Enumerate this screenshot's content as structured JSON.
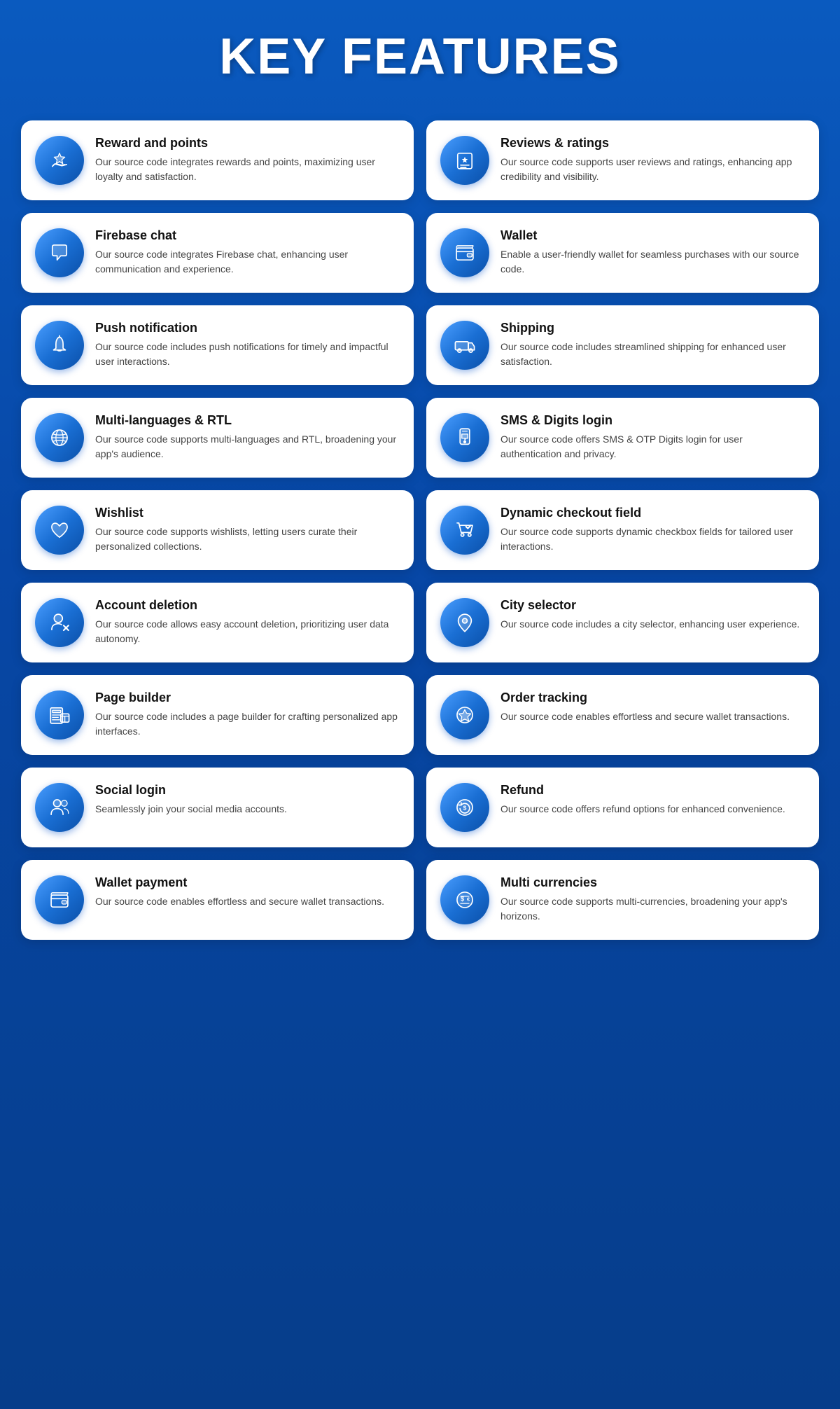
{
  "page": {
    "title": "KEY FEATURES"
  },
  "features": [
    {
      "id": "reward-points",
      "title": "Reward and points",
      "desc": "Our source code integrates rewards and points, maximizing user loyalty and satisfaction.",
      "icon": "star-hand"
    },
    {
      "id": "reviews-ratings",
      "title": "Reviews & ratings",
      "desc": "Our source code supports user reviews and ratings, enhancing app credibility and visibility.",
      "icon": "star-list"
    },
    {
      "id": "firebase-chat",
      "title": "Firebase chat",
      "desc": "Our source code integrates Firebase chat, enhancing user communication and experience.",
      "icon": "chat-bubble"
    },
    {
      "id": "wallet",
      "title": "Wallet",
      "desc": "Enable a user-friendly wallet for seamless purchases with our source code.",
      "icon": "wallet"
    },
    {
      "id": "push-notification",
      "title": "Push notification",
      "desc": "Our source code includes push notifications for timely and impactful user interactions.",
      "icon": "bell"
    },
    {
      "id": "shipping",
      "title": "Shipping",
      "desc": "Our source code includes streamlined shipping for enhanced user satisfaction.",
      "icon": "truck"
    },
    {
      "id": "multi-languages",
      "title": "Multi-languages & RTL",
      "desc": "Our source code supports multi-languages and RTL, broadening your app's audience.",
      "icon": "globe"
    },
    {
      "id": "sms-login",
      "title": "SMS & Digits login",
      "desc": "Our source code offers SMS & OTP Digits login for user authentication and privacy.",
      "icon": "mobile-sms"
    },
    {
      "id": "wishlist",
      "title": "Wishlist",
      "desc": "Our source code supports wishlists, letting users curate their personalized collections.",
      "icon": "heart"
    },
    {
      "id": "dynamic-checkout",
      "title": "Dynamic checkout field",
      "desc": "Our source code supports dynamic checkbox fields for tailored user interactions.",
      "icon": "cart-check"
    },
    {
      "id": "account-deletion",
      "title": "Account deletion",
      "desc": "Our source code allows easy account deletion, prioritizing user data autonomy.",
      "icon": "user-x"
    },
    {
      "id": "city-selector",
      "title": "City selector",
      "desc": "Our source code includes a city selector, enhancing user experience.",
      "icon": "location-pin"
    },
    {
      "id": "page-builder",
      "title": "Page builder",
      "desc": "Our source code includes a page builder for crafting personalized app interfaces.",
      "icon": "page-builder"
    },
    {
      "id": "order-tracking",
      "title": "Order tracking",
      "desc": "Our source code enables effortless and secure wallet transactions.",
      "icon": "order-track"
    },
    {
      "id": "social-login",
      "title": "Social login",
      "desc": "Seamlessly join your social media accounts.",
      "icon": "social-people"
    },
    {
      "id": "refund",
      "title": "Refund",
      "desc": "Our source code offers refund options for enhanced convenience.",
      "icon": "refund"
    },
    {
      "id": "wallet-payment",
      "title": "Wallet payment",
      "desc": "Our source code enables effortless and secure wallet transactions.",
      "icon": "wallet2"
    },
    {
      "id": "multi-currencies",
      "title": "Multi currencies",
      "desc": "Our source code supports multi-currencies, broadening your app's horizons.",
      "icon": "multi-currency"
    }
  ]
}
